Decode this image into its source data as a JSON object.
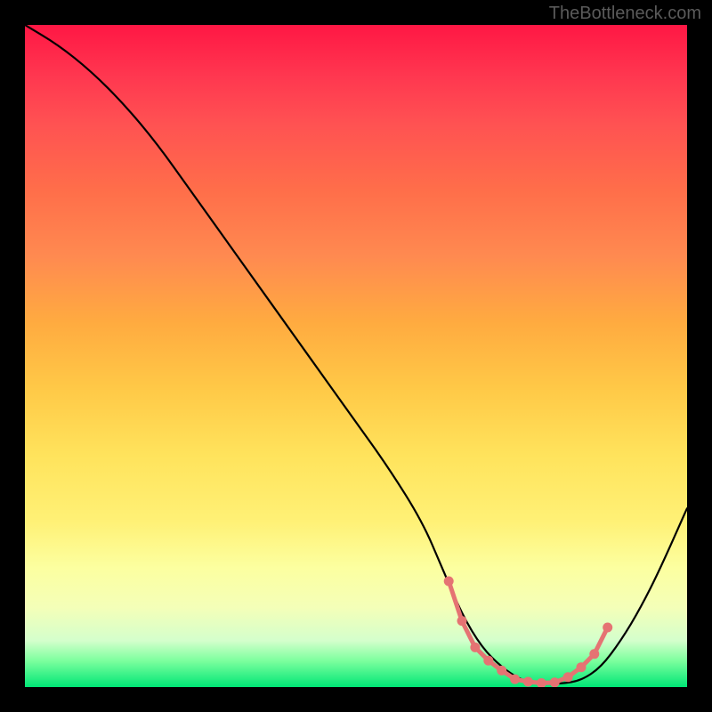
{
  "watermark": "TheBottleneck.com",
  "chart_data": {
    "type": "line",
    "title": "",
    "xlabel": "",
    "ylabel": "",
    "xlim": [
      0,
      100
    ],
    "ylim": [
      0,
      100
    ],
    "series": [
      {
        "name": "bottleneck-curve",
        "x": [
          0,
          5,
          10,
          15,
          20,
          25,
          30,
          35,
          40,
          45,
          50,
          55,
          60,
          63,
          66,
          69,
          72,
          75,
          78,
          81,
          84,
          87,
          90,
          93,
          96,
          100
        ],
        "values": [
          100,
          97,
          93,
          88,
          82,
          75,
          68,
          61,
          54,
          47,
          40,
          33,
          25,
          18,
          11,
          6,
          3,
          1,
          0.5,
          0.5,
          1,
          3,
          7,
          12,
          18,
          27
        ]
      }
    ],
    "markers": {
      "name": "highlight-zone",
      "color": "#e57373",
      "points_x": [
        64,
        66,
        68,
        70,
        72,
        74,
        76,
        78,
        80,
        82,
        84,
        86,
        88
      ],
      "points_y": [
        16,
        10,
        6,
        4,
        2.5,
        1.2,
        0.8,
        0.6,
        0.7,
        1.5,
        3,
        5,
        9
      ]
    },
    "gradient_stops": [
      {
        "pos": 0,
        "color": "#ff1744"
      },
      {
        "pos": 50,
        "color": "#ffc107"
      },
      {
        "pos": 85,
        "color": "#fff59d"
      },
      {
        "pos": 100,
        "color": "#00e676"
      }
    ]
  }
}
